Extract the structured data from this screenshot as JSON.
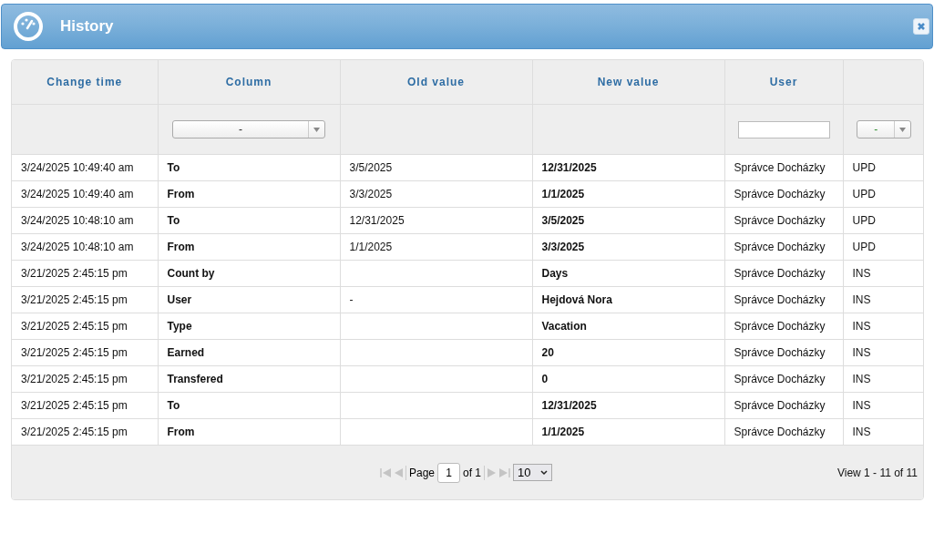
{
  "window": {
    "title": "History"
  },
  "table": {
    "columns": [
      "Change time",
      "Column",
      "Old value",
      "New value",
      "User",
      ""
    ],
    "filters": [
      {
        "kind": "none"
      },
      {
        "kind": "select",
        "value": "-"
      },
      {
        "kind": "none"
      },
      {
        "kind": "none"
      },
      {
        "kind": "text"
      },
      {
        "kind": "select",
        "value": "-"
      }
    ],
    "rows": [
      [
        "3/24/2025 10:49:40 am",
        "To",
        "3/5/2025",
        "12/31/2025",
        "Správce Docházky",
        "UPD"
      ],
      [
        "3/24/2025 10:49:40 am",
        "From",
        "3/3/2025",
        "1/1/2025",
        "Správce Docházky",
        "UPD"
      ],
      [
        "3/24/2025 10:48:10 am",
        "To",
        "12/31/2025",
        "3/5/2025",
        "Správce Docházky",
        "UPD"
      ],
      [
        "3/24/2025 10:48:10 am",
        "From",
        "1/1/2025",
        "3/3/2025",
        "Správce Docházky",
        "UPD"
      ],
      [
        "3/21/2025 2:45:15 pm",
        "Count by",
        "",
        "Days",
        "Správce Docházky",
        "INS"
      ],
      [
        "3/21/2025 2:45:15 pm",
        "User",
        "-",
        "Hejdová Nora",
        "Správce Docházky",
        "INS"
      ],
      [
        "3/21/2025 2:45:15 pm",
        "Type",
        "",
        "Vacation",
        "Správce Docházky",
        "INS"
      ],
      [
        "3/21/2025 2:45:15 pm",
        "Earned",
        "",
        "20",
        "Správce Docházky",
        "INS"
      ],
      [
        "3/21/2025 2:45:15 pm",
        "Transfered",
        "",
        "0",
        "Správce Docházky",
        "INS"
      ],
      [
        "3/21/2025 2:45:15 pm",
        "To",
        "",
        "12/31/2025",
        "Správce Docházky",
        "INS"
      ],
      [
        "3/21/2025 2:45:15 pm",
        "From",
        "",
        "1/1/2025",
        "Správce Docházky",
        "INS"
      ]
    ]
  },
  "pager": {
    "first_disabled": true,
    "prev_disabled": true,
    "next_disabled": true,
    "last_disabled": true,
    "page_label": "Page",
    "page": "1",
    "of_label": "of 1",
    "page_size": "10",
    "summary": "View 1 - 11 of 11"
  }
}
